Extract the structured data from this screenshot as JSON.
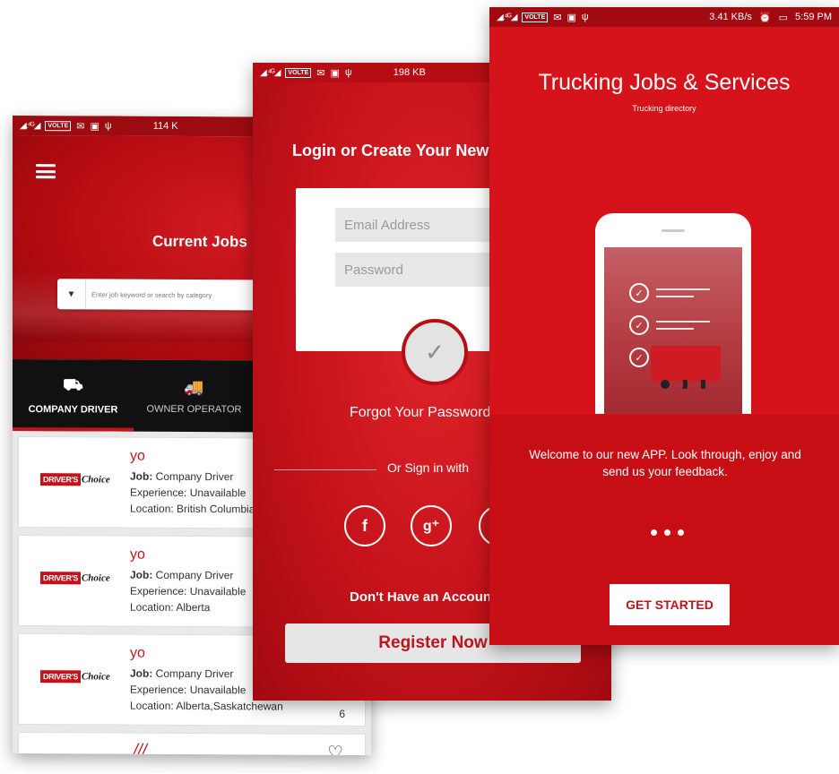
{
  "phone_jobs": {
    "status": {
      "signal": "◢.⁴ᴳ◢",
      "volte": "VOLTE",
      "speed": "114 K"
    },
    "header_title": "Current Jobs",
    "search": {
      "placeholder": "Enter job keyword or search by category"
    },
    "tabs": [
      {
        "label": "COMPANY DRIVER",
        "icon": "truck-front-icon"
      },
      {
        "label": "OWNER OPERATOR",
        "icon": "truck-side-icon"
      }
    ],
    "jobs": [
      {
        "logo_red": "DRIVER'S",
        "logo_black": "Choice",
        "title": "yo",
        "job_label": "Job:",
        "job_value": " Company Driver",
        "experience": "Experience: Unavailable",
        "location": "Location: British Columbia",
        "corner": ""
      },
      {
        "logo_red": "DRIVER'S",
        "logo_black": "Choice",
        "title": "yo",
        "job_label": "Job:",
        "job_value": " Company Driver",
        "experience": "Experience: Unavailable",
        "location": "Location: Alberta",
        "corner": ""
      },
      {
        "logo_red": "DRIVER'S",
        "logo_black": "Choice",
        "title": "yo",
        "job_label": "Job:",
        "job_value": " Company Driver",
        "experience": "Experience: Unavailable",
        "location": "Location: Alberta,Saskatchewan",
        "corner": "6"
      }
    ]
  },
  "phone_login": {
    "status": {
      "signal": "◢.⁴ᴳ◢",
      "volte": "VOLTE",
      "speed": "198 KB"
    },
    "title": "Login or Create Your New Account",
    "email_placeholder": "Email Address",
    "password_placeholder": "Password",
    "check": "✓",
    "forgot": "Forgot Your Password?",
    "or_sign_in": "Or Sign in with",
    "social": {
      "facebook": "f",
      "google": "g⁺",
      "twitter": "t"
    },
    "no_account": "Don't Have an Account?",
    "register": "Register Now"
  },
  "phone_welcome": {
    "status": {
      "signal": "◢.⁴ᴳ◢",
      "volte": "VOLTE",
      "speed": "3.41 KB/s",
      "time": "5:59 PM"
    },
    "title": "Trucking Jobs & Services",
    "subtitle": "Trucking directory",
    "welcome_text": "Welcome to our new APP. Look through, enjoy and send us your feedback.",
    "get_started": "GET STARTED"
  },
  "colors": {
    "brand_red": "#d6121a",
    "dark_red": "#9c0b10",
    "tab_bar": "#111111"
  }
}
